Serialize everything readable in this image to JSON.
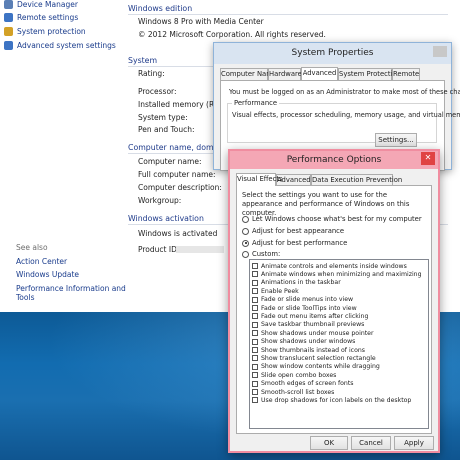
{
  "sidebar": {
    "items": [
      {
        "label": "Device Manager",
        "color": "#5a7fb5"
      },
      {
        "label": "Remote settings",
        "color": "#3d74c4"
      },
      {
        "label": "System protection",
        "color": "#d3a126"
      },
      {
        "label": "Advanced system settings",
        "color": "#3d74c4"
      }
    ],
    "see_also": "See also",
    "links": [
      "Action Center",
      "Windows Update",
      "Performance Information and",
      "Tools"
    ]
  },
  "main": {
    "edition_header": "Windows edition",
    "edition_value": "Windows 8 Pro with Media Center",
    "copyright": "© 2012 Microsoft Corporation. All rights reserved.",
    "system_header": "System",
    "system_labels": [
      "Rating:",
      "Processor:",
      "Installed memory (RAM):",
      "System type:",
      "Pen and Touch:"
    ],
    "computer_header": "Computer name, domain, a",
    "computer_labels": [
      "Computer name:",
      "Full computer name:",
      "Computer description:",
      "Workgroup:"
    ],
    "activation_header": "Windows activation",
    "activation_status": "Windows is activated",
    "activation_link": "V",
    "product_id_label": "Product ID:"
  },
  "system_properties": {
    "title": "System Properties",
    "tabs": [
      "Computer Name",
      "Hardware",
      "Advanced",
      "System Protection",
      "Remote"
    ],
    "selected_tab": "Advanced",
    "admin_note": "You must be logged on as an Administrator to make most of these changes.",
    "perf_group": "Performance",
    "perf_desc": "Visual effects, processor scheduling, memory usage, and virtual memory",
    "settings_button": "Settings..."
  },
  "performance_options": {
    "title": "Performance Options",
    "close_glyph": "✕",
    "tabs": [
      "Visual Effects",
      "Advanced",
      "Data Execution Prevention"
    ],
    "selected_tab": "Visual Effects",
    "description": "Select the settings you want to use for the appearance and performance of Windows on this computer.",
    "radios": [
      {
        "label": "Let Windows choose what's best for my computer",
        "selected": false
      },
      {
        "label": "Adjust for best appearance",
        "selected": false
      },
      {
        "label": "Adjust for best performance",
        "selected": true
      },
      {
        "label": "Custom:",
        "selected": false
      }
    ],
    "checkboxes": [
      "Animate controls and elements inside windows",
      "Animate windows when minimizing and maximizing",
      "Animations in the taskbar",
      "Enable Peek",
      "Fade or slide menus into view",
      "Fade or slide ToolTips into view",
      "Fade out menu items after clicking",
      "Save taskbar thumbnail previews",
      "Show shadows under mouse pointer",
      "Show shadows under windows",
      "Show thumbnails instead of icons",
      "Show translucent selection rectangle",
      "Show window contents while dragging",
      "Slide open combo boxes",
      "Smooth edges of screen fonts",
      "Smooth-scroll list boxes",
      "Use drop shadows for icon labels on the desktop"
    ],
    "buttons": {
      "ok": "OK",
      "cancel": "Cancel",
      "apply": "Apply"
    }
  }
}
